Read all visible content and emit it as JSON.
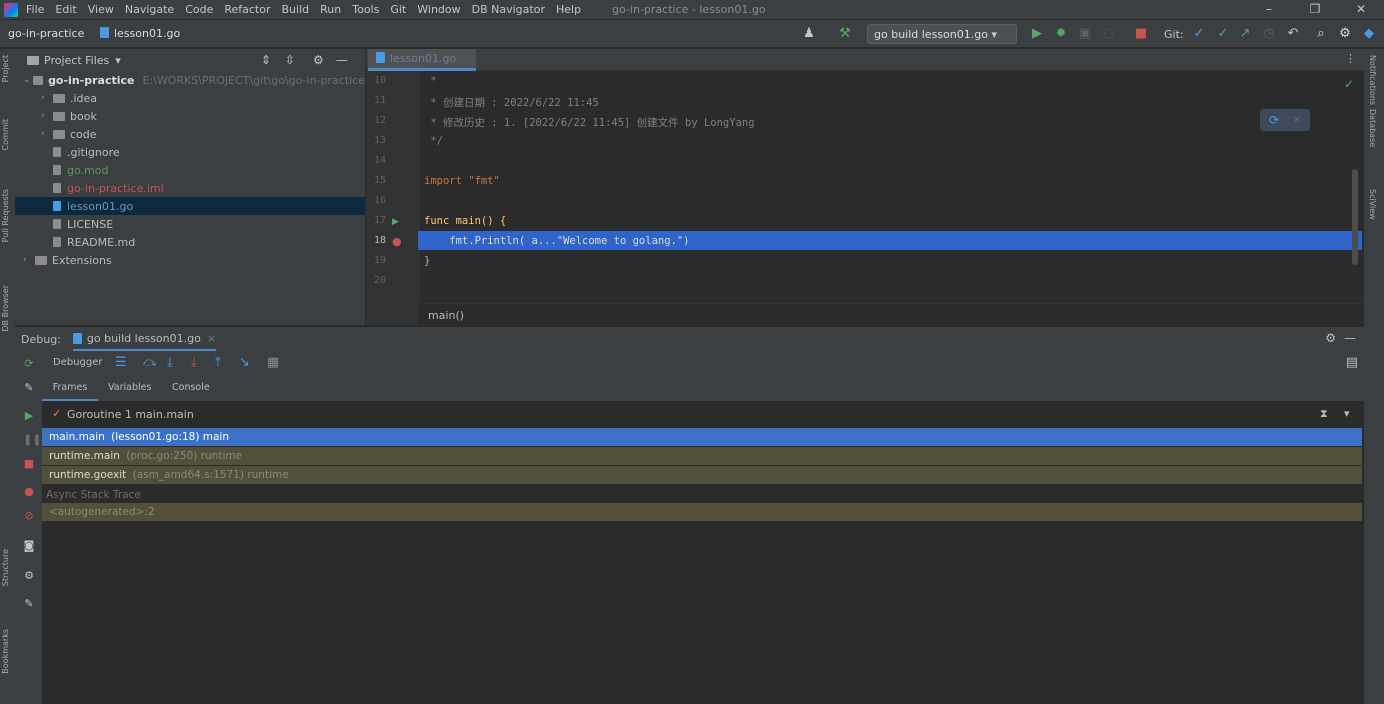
{
  "menu": [
    "File",
    "Edit",
    "View",
    "Navigate",
    "Code",
    "Refactor",
    "Build",
    "Run",
    "Tools",
    "Git",
    "Window",
    "DB Navigator",
    "Help"
  ],
  "window_title": "go-in-practice - lesson01.go",
  "toolbar": {
    "project": "go-in-practice",
    "file": "lesson01.go",
    "run_config": "go build lesson01.go",
    "git_label": "Git:"
  },
  "left_tools": [
    "Project",
    "Commit",
    "Pull Requests",
    "DB Browser",
    "Structure",
    "Bookmarks"
  ],
  "right_tools": [
    "Notifications",
    "Database",
    "SciView"
  ],
  "project_panel": {
    "header": "Project Files",
    "tree": [
      {
        "label": "go-in-practice",
        "path": "E:\\WORKS\\PROJECT\\git\\go\\go-in-practice",
        "type": "folder",
        "depth": 0,
        "open": true
      },
      {
        "label": ".idea",
        "type": "folder",
        "depth": 1
      },
      {
        "label": "book",
        "type": "folder",
        "depth": 1
      },
      {
        "label": "code",
        "type": "folder",
        "depth": 1
      },
      {
        "label": ".gitignore",
        "type": "file",
        "depth": 1,
        "color": "#bbbbbb"
      },
      {
        "label": "go.mod",
        "type": "file",
        "depth": 1,
        "color": "#629755"
      },
      {
        "label": "go-in-practice.iml",
        "type": "file",
        "depth": 1,
        "color": "#c75450"
      },
      {
        "label": "lesson01.go",
        "type": "file",
        "depth": 1,
        "color": "#6897bb",
        "selected": true
      },
      {
        "label": "LICENSE",
        "type": "file",
        "depth": 1,
        "color": "#bbbbbb"
      },
      {
        "label": "README.md",
        "type": "file",
        "depth": 1,
        "color": "#bbbbbb"
      },
      {
        "label": "Extensions",
        "type": "folder",
        "depth": 0
      }
    ]
  },
  "editor": {
    "tab": "lesson01.go",
    "lines": [
      {
        "n": "10",
        "text": " *"
      },
      {
        "n": "11",
        "text": " * 创建日期 : 2022/6/22 11:45"
      },
      {
        "n": "12",
        "text": " * 修改历史 : 1. [2022/6/22 11:45] 创建文件 by LongYang"
      },
      {
        "n": "13",
        "text": " */"
      },
      {
        "n": "14",
        "text": ""
      },
      {
        "n": "15",
        "text": "import \"fmt\""
      },
      {
        "n": "16",
        "text": ""
      },
      {
        "n": "17",
        "text": "func main() {"
      },
      {
        "n": "18",
        "text": "    fmt.Println( a...\"Welcome to golang.\")"
      },
      {
        "n": "19",
        "text": "}"
      },
      {
        "n": "20",
        "text": ""
      }
    ],
    "breadcrumb": "main()"
  },
  "debug": {
    "title": "Debug:",
    "session_tab": "go build lesson01.go",
    "debugger_label": "Debugger",
    "tabs": [
      "Frames",
      "Variables",
      "Console"
    ],
    "goroutine": "Goroutine 1 main.main",
    "frames": [
      {
        "fn": "main.main",
        "loc": "(lesson01.go:18) main",
        "selected": true
      },
      {
        "fn": "runtime.main",
        "loc": "(proc.go:250) runtime"
      },
      {
        "fn": "runtime.goexit",
        "loc": "(asm_amd64.s:1571) runtime"
      }
    ],
    "async_label": "Async Stack Trace",
    "autogen": "<autogenerated>:2"
  }
}
